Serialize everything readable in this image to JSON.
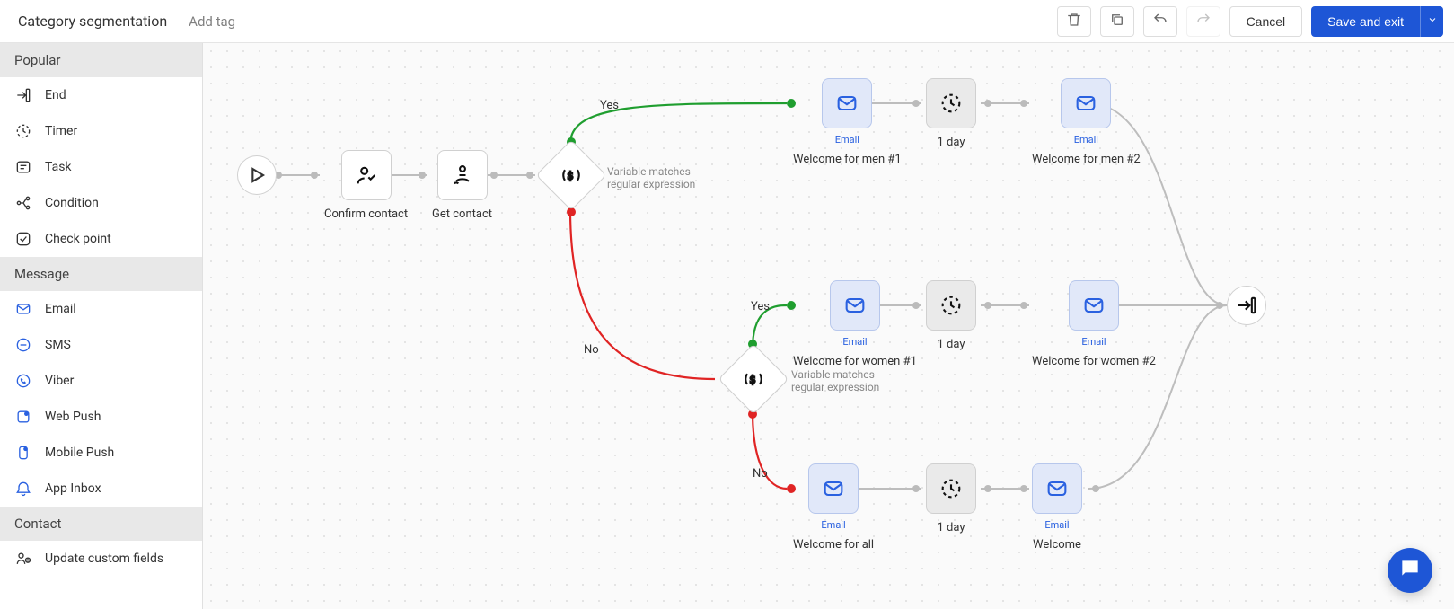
{
  "header": {
    "title": "Category segmentation",
    "add_tag": "Add tag",
    "cancel": "Cancel",
    "save": "Save and exit"
  },
  "sidebar": {
    "sections": {
      "popular": {
        "title": "Popular",
        "items": [
          "End",
          "Timer",
          "Task",
          "Condition",
          "Check point"
        ]
      },
      "message": {
        "title": "Message",
        "items": [
          "Email",
          "SMS",
          "Viber",
          "Web Push",
          "Mobile Push",
          "App Inbox"
        ]
      },
      "contact": {
        "title": "Contact",
        "items": [
          "Update custom fields"
        ]
      }
    }
  },
  "flow": {
    "condition_desc": "Variable matches regular expression",
    "nodes": {
      "confirm": {
        "label": "Confirm contact"
      },
      "get": {
        "label": "Get contact"
      },
      "email_men1": {
        "sub": "Email",
        "label": "Welcome for men #1"
      },
      "email_men2": {
        "sub": "Email",
        "label": "Welcome for men #2"
      },
      "email_women1": {
        "sub": "Email",
        "label": "Welcome for women #1"
      },
      "email_women2": {
        "sub": "Email",
        "label": "Welcome for women #2"
      },
      "email_all": {
        "sub": "Email",
        "label": "Welcome for all"
      },
      "email_welcome": {
        "sub": "Email",
        "label": "Welcome"
      },
      "timer1": {
        "label": "1 day"
      },
      "timer2": {
        "label": "1 day"
      },
      "timer3": {
        "label": "1 day"
      }
    },
    "labels": {
      "yes": "Yes",
      "no": "No"
    }
  }
}
